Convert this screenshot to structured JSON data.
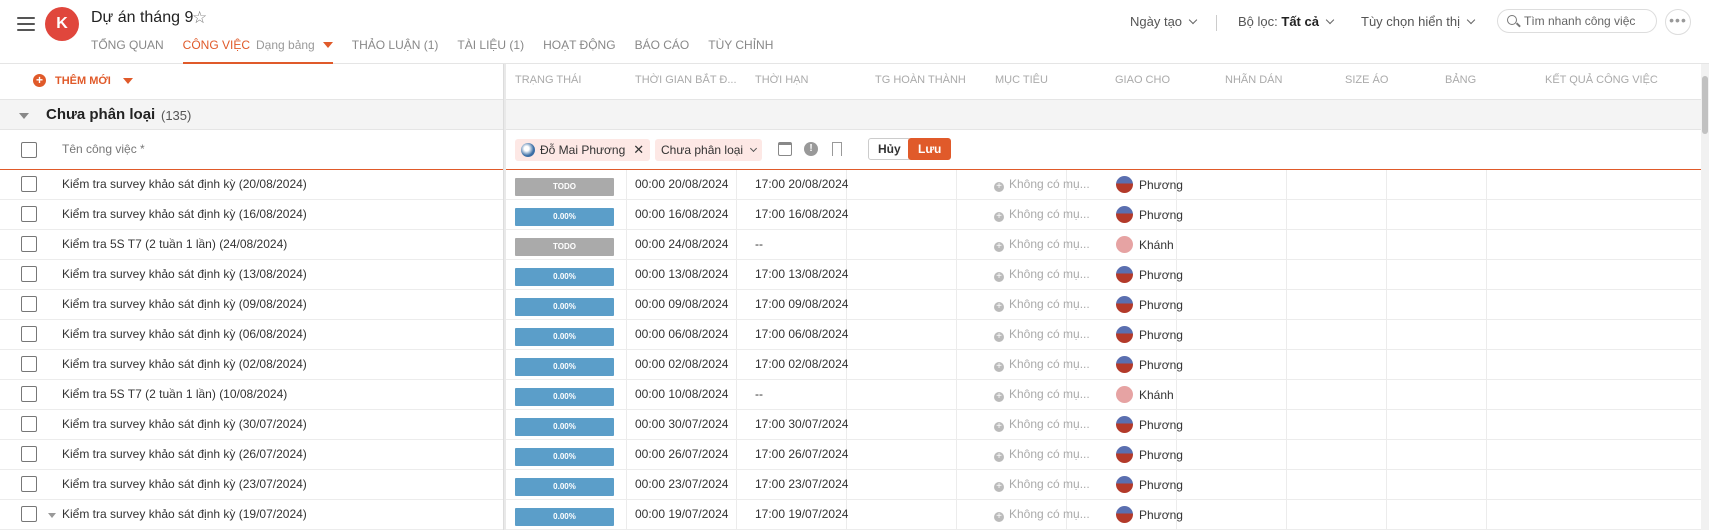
{
  "header": {
    "title": "Dự án tháng 9",
    "logo_letter": "K",
    "tabs": [
      {
        "label": "TỔNG QUAN",
        "sub": ""
      },
      {
        "label": "CÔNG VIỆC",
        "sub": "Dạng bảng"
      },
      {
        "label": "THẢO LUẬN (1)",
        "sub": ""
      },
      {
        "label": "TÀI LIỆU (1)",
        "sub": ""
      },
      {
        "label": "HOẠT ĐỘNG",
        "sub": ""
      },
      {
        "label": "BÁO CÁO",
        "sub": ""
      },
      {
        "label": "TÙY CHỈNH",
        "sub": ""
      }
    ],
    "sort_label": "Ngày tạo",
    "filter_prefix": "Bộ lọc:",
    "filter_value": "Tất cả",
    "view_options": "Tùy chọn hiển thị",
    "search_placeholder": "Tìm nhanh công việc",
    "more": "•••"
  },
  "toolbar": {
    "add_new": "THÊM MỚI",
    "plus": "+"
  },
  "columns": [
    "TRẠNG THÁI",
    "THỜI GIAN BẮT Đ...",
    "THỜI HẠN",
    "TG HOÀN THÀNH",
    "MỤC TIÊU",
    "GIAO CHO",
    "NHÃN DÁN",
    "SIZE ÁO",
    "BẢNG",
    "KẾT QUẢ CÔNG VIỆC"
  ],
  "group": {
    "name": "Chưa phân loại",
    "count": "(135)"
  },
  "new_task": {
    "placeholder": "Tên công việc *",
    "assignee_chip": "Đỗ Mai Phương",
    "remove": "✕",
    "category_chip": "Chưa phân loại",
    "warn": "!",
    "cancel": "Hủy",
    "save": "Lưu"
  },
  "goal_placeholder": "Không có mụ...",
  "goal_icon": "+",
  "tasks": [
    {
      "name": "Kiểm tra survey khảo sát định kỳ (20/08/2024)",
      "status": "TODO",
      "start": "00:00 20/08/2024",
      "due": "17:00 20/08/2024",
      "assignee": "Phương"
    },
    {
      "name": "Kiểm tra survey khảo sát định kỳ (16/08/2024)",
      "status": "0.00%",
      "start": "00:00 16/08/2024",
      "due": "17:00 16/08/2024",
      "assignee": "Phương"
    },
    {
      "name": "Kiểm tra 5S T7 (2 tuần 1 lần) (24/08/2024)",
      "status": "TODO",
      "start": "00:00 24/08/2024",
      "due": "--",
      "assignee": "Khánh"
    },
    {
      "name": "Kiểm tra survey khảo sát định kỳ (13/08/2024)",
      "status": "0.00%",
      "start": "00:00 13/08/2024",
      "due": "17:00 13/08/2024",
      "assignee": "Phương"
    },
    {
      "name": "Kiểm tra survey khảo sát định kỳ (09/08/2024)",
      "status": "0.00%",
      "start": "00:00 09/08/2024",
      "due": "17:00 09/08/2024",
      "assignee": "Phương"
    },
    {
      "name": "Kiểm tra survey khảo sát định kỳ (06/08/2024)",
      "status": "0.00%",
      "start": "00:00 06/08/2024",
      "due": "17:00 06/08/2024",
      "assignee": "Phương"
    },
    {
      "name": "Kiểm tra survey khảo sát định kỳ (02/08/2024)",
      "status": "0.00%",
      "start": "00:00 02/08/2024",
      "due": "17:00 02/08/2024",
      "assignee": "Phương"
    },
    {
      "name": "Kiểm tra 5S T7 (2 tuần 1 lần) (10/08/2024)",
      "status": "0.00%",
      "start": "00:00 10/08/2024",
      "due": "--",
      "assignee": "Khánh"
    },
    {
      "name": "Kiểm tra survey khảo sát định kỳ (30/07/2024)",
      "status": "0.00%",
      "start": "00:00 30/07/2024",
      "due": "17:00 30/07/2024",
      "assignee": "Phương"
    },
    {
      "name": "Kiểm tra survey khảo sát định kỳ (26/07/2024)",
      "status": "0.00%",
      "start": "00:00 26/07/2024",
      "due": "17:00 26/07/2024",
      "assignee": "Phương"
    },
    {
      "name": "Kiểm tra survey khảo sát định kỳ (23/07/2024)",
      "status": "0.00%",
      "start": "00:00 23/07/2024",
      "due": "17:00 23/07/2024",
      "assignee": "Phương"
    },
    {
      "name": "Kiểm tra survey khảo sát định kỳ (19/07/2024)",
      "status": "0.00%",
      "start": "00:00 19/07/2024",
      "due": "17:00 19/07/2024",
      "assignee": "Phương"
    }
  ]
}
